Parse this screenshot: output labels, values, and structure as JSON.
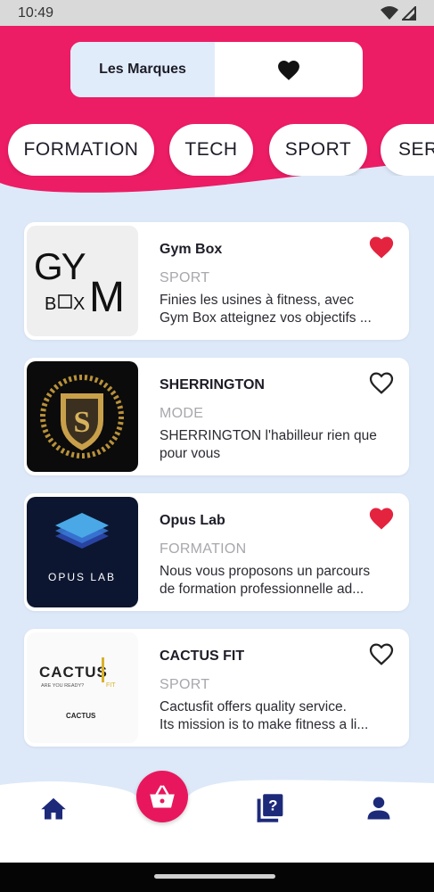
{
  "status_bar": {
    "time": "10:49"
  },
  "colors": {
    "accent": "#e8175d",
    "nav_icon": "#1d2a7a",
    "background": "#dde9f9"
  },
  "segmented": {
    "left_label": "Les Marques",
    "right_icon": "heart-icon"
  },
  "categories": [
    "FORMATION",
    "TECH",
    "SPORT",
    "SER"
  ],
  "brands": [
    {
      "name": "Gym Box",
      "category": "SPORT",
      "desc_line1": "Finies les usines à fitness, avec",
      "desc_line2": "Gym Box atteignez vos objectifs ...",
      "favorite": true,
      "logo_text": "GYM BOX"
    },
    {
      "name": "SHERRINGTON",
      "category": "MODE",
      "desc_line1": "SHERRINGTON l'habilleur rien que",
      "desc_line2": "pour vous",
      "favorite": false,
      "logo_text": "S"
    },
    {
      "name": "Opus Lab",
      "category": "FORMATION",
      "desc_line1": "Nous vous proposons un parcours",
      "desc_line2": "de formation professionnelle ad...",
      "favorite": true,
      "logo_text": "OPUS LAB"
    },
    {
      "name": "CACTUS FIT",
      "category": "SPORT",
      "desc_line1": "Cactusfit offers quality service.",
      "desc_line2": "Its mission is to make fitness a li...",
      "favorite": false,
      "logo_text": "CACTUS FIT",
      "logo_tagline": "ARE YOU READY?"
    }
  ],
  "bottom_nav": [
    "home-icon",
    "basket-icon",
    "help-book-icon",
    "user-icon"
  ]
}
